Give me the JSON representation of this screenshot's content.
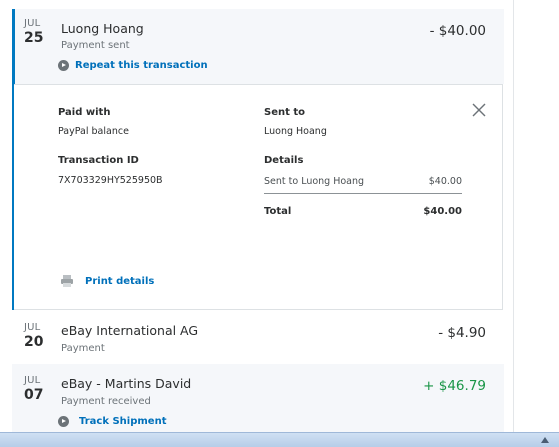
{
  "transactions": [
    {
      "month": "JUL",
      "day": "25",
      "name": "Luong Hoang",
      "status": "Payment sent",
      "amount": "- $40.00",
      "action": "Repeat this transaction",
      "expanded": true
    },
    {
      "month": "JUL",
      "day": "20",
      "name": "eBay International AG",
      "status": "Payment",
      "amount": "- $4.90"
    },
    {
      "month": "JUL",
      "day": "07",
      "name": "eBay - Martins David",
      "status": "Payment received",
      "amount": "+ $46.79",
      "action": "Track Shipment"
    }
  ],
  "details": {
    "paid_with_label": "Paid with",
    "paid_with_value": "PayPal balance",
    "transaction_id_label": "Transaction ID",
    "transaction_id_value": "7X703329HY525950B",
    "sent_to_label": "Sent to",
    "sent_to_value": "Luong Hoang",
    "details_label": "Details",
    "line_item_label": "Sent to Luong Hoang",
    "line_item_amount": "$40.00",
    "total_label": "Total",
    "total_amount": "$40.00",
    "print_label": "Print details"
  },
  "colors": {
    "accent": "#0079c1",
    "link": "#0070ba",
    "positive": "#1a9547"
  }
}
